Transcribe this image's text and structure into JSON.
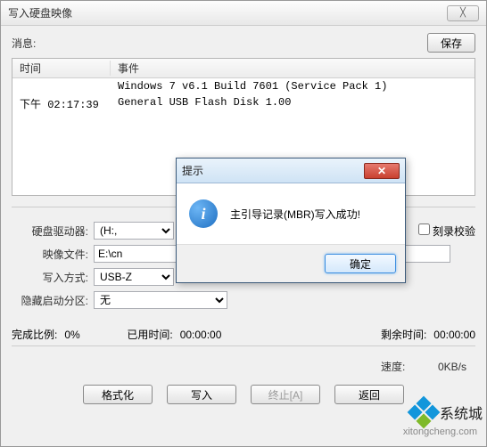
{
  "window": {
    "title": "写入硬盘映像",
    "close_glyph": "╳"
  },
  "toolbar": {
    "message_label": "消息:",
    "save_label": "保存"
  },
  "log": {
    "col_time": "时间",
    "col_event": "事件",
    "rows": [
      {
        "time": "",
        "event": "Windows 7 v6.1 Build 7601 (Service Pack 1)"
      },
      {
        "time": "下午 02:17:39",
        "event": "General USB Flash Disk  1.00"
      }
    ]
  },
  "form": {
    "drive_label": "硬盘驱动器:",
    "drive_value": "(H:,",
    "verify_label": "刻录校验",
    "image_label": "映像文件:",
    "image_value": "E:\\cn",
    "mode_label": "写入方式:",
    "mode_value": "USB-Z",
    "hide_label": "隐藏启动分区:",
    "hide_value": "无"
  },
  "progress": {
    "done_label": "完成比例:",
    "done_value": "0%",
    "elapsed_label": "已用时间:",
    "elapsed_value": "00:00:00",
    "remain_label": "剩余时间:",
    "remain_value": "00:00:00",
    "speed_label": "速度:",
    "speed_value": "0KB/s"
  },
  "buttons": {
    "format": "格式化",
    "write": "写入",
    "abort": "终止[A]",
    "back": "返回"
  },
  "modal": {
    "title": "提示",
    "message": "主引导记录(MBR)写入成功!",
    "ok": "确定",
    "close_glyph": "✕"
  },
  "watermark": {
    "brand": "系统城",
    "url": "xitongcheng.com"
  }
}
